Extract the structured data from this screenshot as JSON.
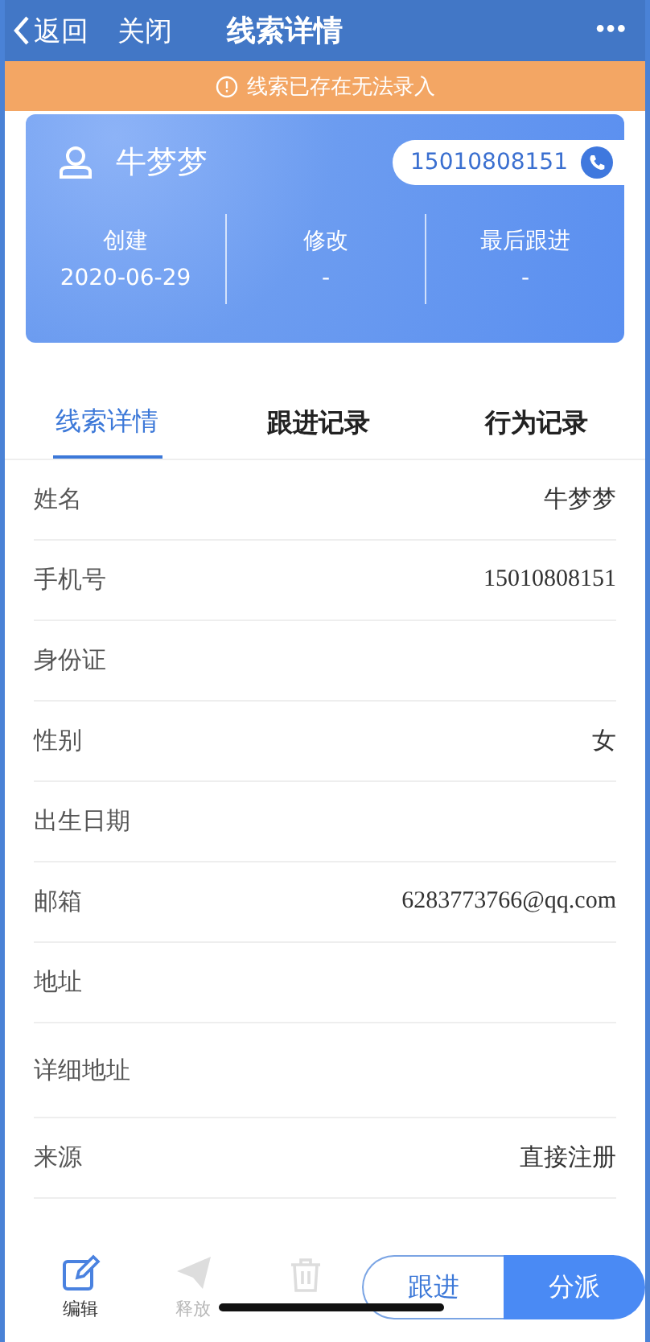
{
  "nav_bar": {
    "back": "返回",
    "close": "关闭",
    "title": "线索详情",
    "more": "•••"
  },
  "banner": {
    "text": "线索已存在无法录入"
  },
  "header_card": {
    "name": "牛梦梦",
    "phone": "15010808151",
    "stats": [
      {
        "label": "创建",
        "value": "2020-06-29"
      },
      {
        "label": "修改",
        "value": "-"
      },
      {
        "label": "最后跟进",
        "value": "-"
      }
    ]
  },
  "tabs": [
    {
      "label": "线索详情",
      "selected": true
    },
    {
      "label": "跟进记录",
      "selected": false
    },
    {
      "label": "行为记录",
      "selected": false
    }
  ],
  "fields": [
    {
      "label": "姓名",
      "value": "牛梦梦"
    },
    {
      "label": "手机号",
      "value": "15010808151"
    },
    {
      "label": "身份证"
    },
    {
      "label": "性别",
      "value": "女"
    },
    {
      "label": "出生日期"
    },
    {
      "label": "邮箱",
      "value": "6283773766@qq.com"
    },
    {
      "label": "地址"
    },
    {
      "label": "详细地址"
    },
    {
      "label": "来源",
      "value": "直接注册"
    }
  ],
  "toolbar": {
    "actions": [
      {
        "kind": "edit",
        "label": "编辑",
        "disabled": false
      },
      {
        "kind": "send",
        "label": "释放",
        "disabled": true
      },
      {
        "kind": "trash",
        "disabled": true
      }
    ],
    "buttons": [
      {
        "kind": "outline",
        "label": "跟进"
      },
      {
        "kind": "filled",
        "label": "分派"
      }
    ]
  }
}
